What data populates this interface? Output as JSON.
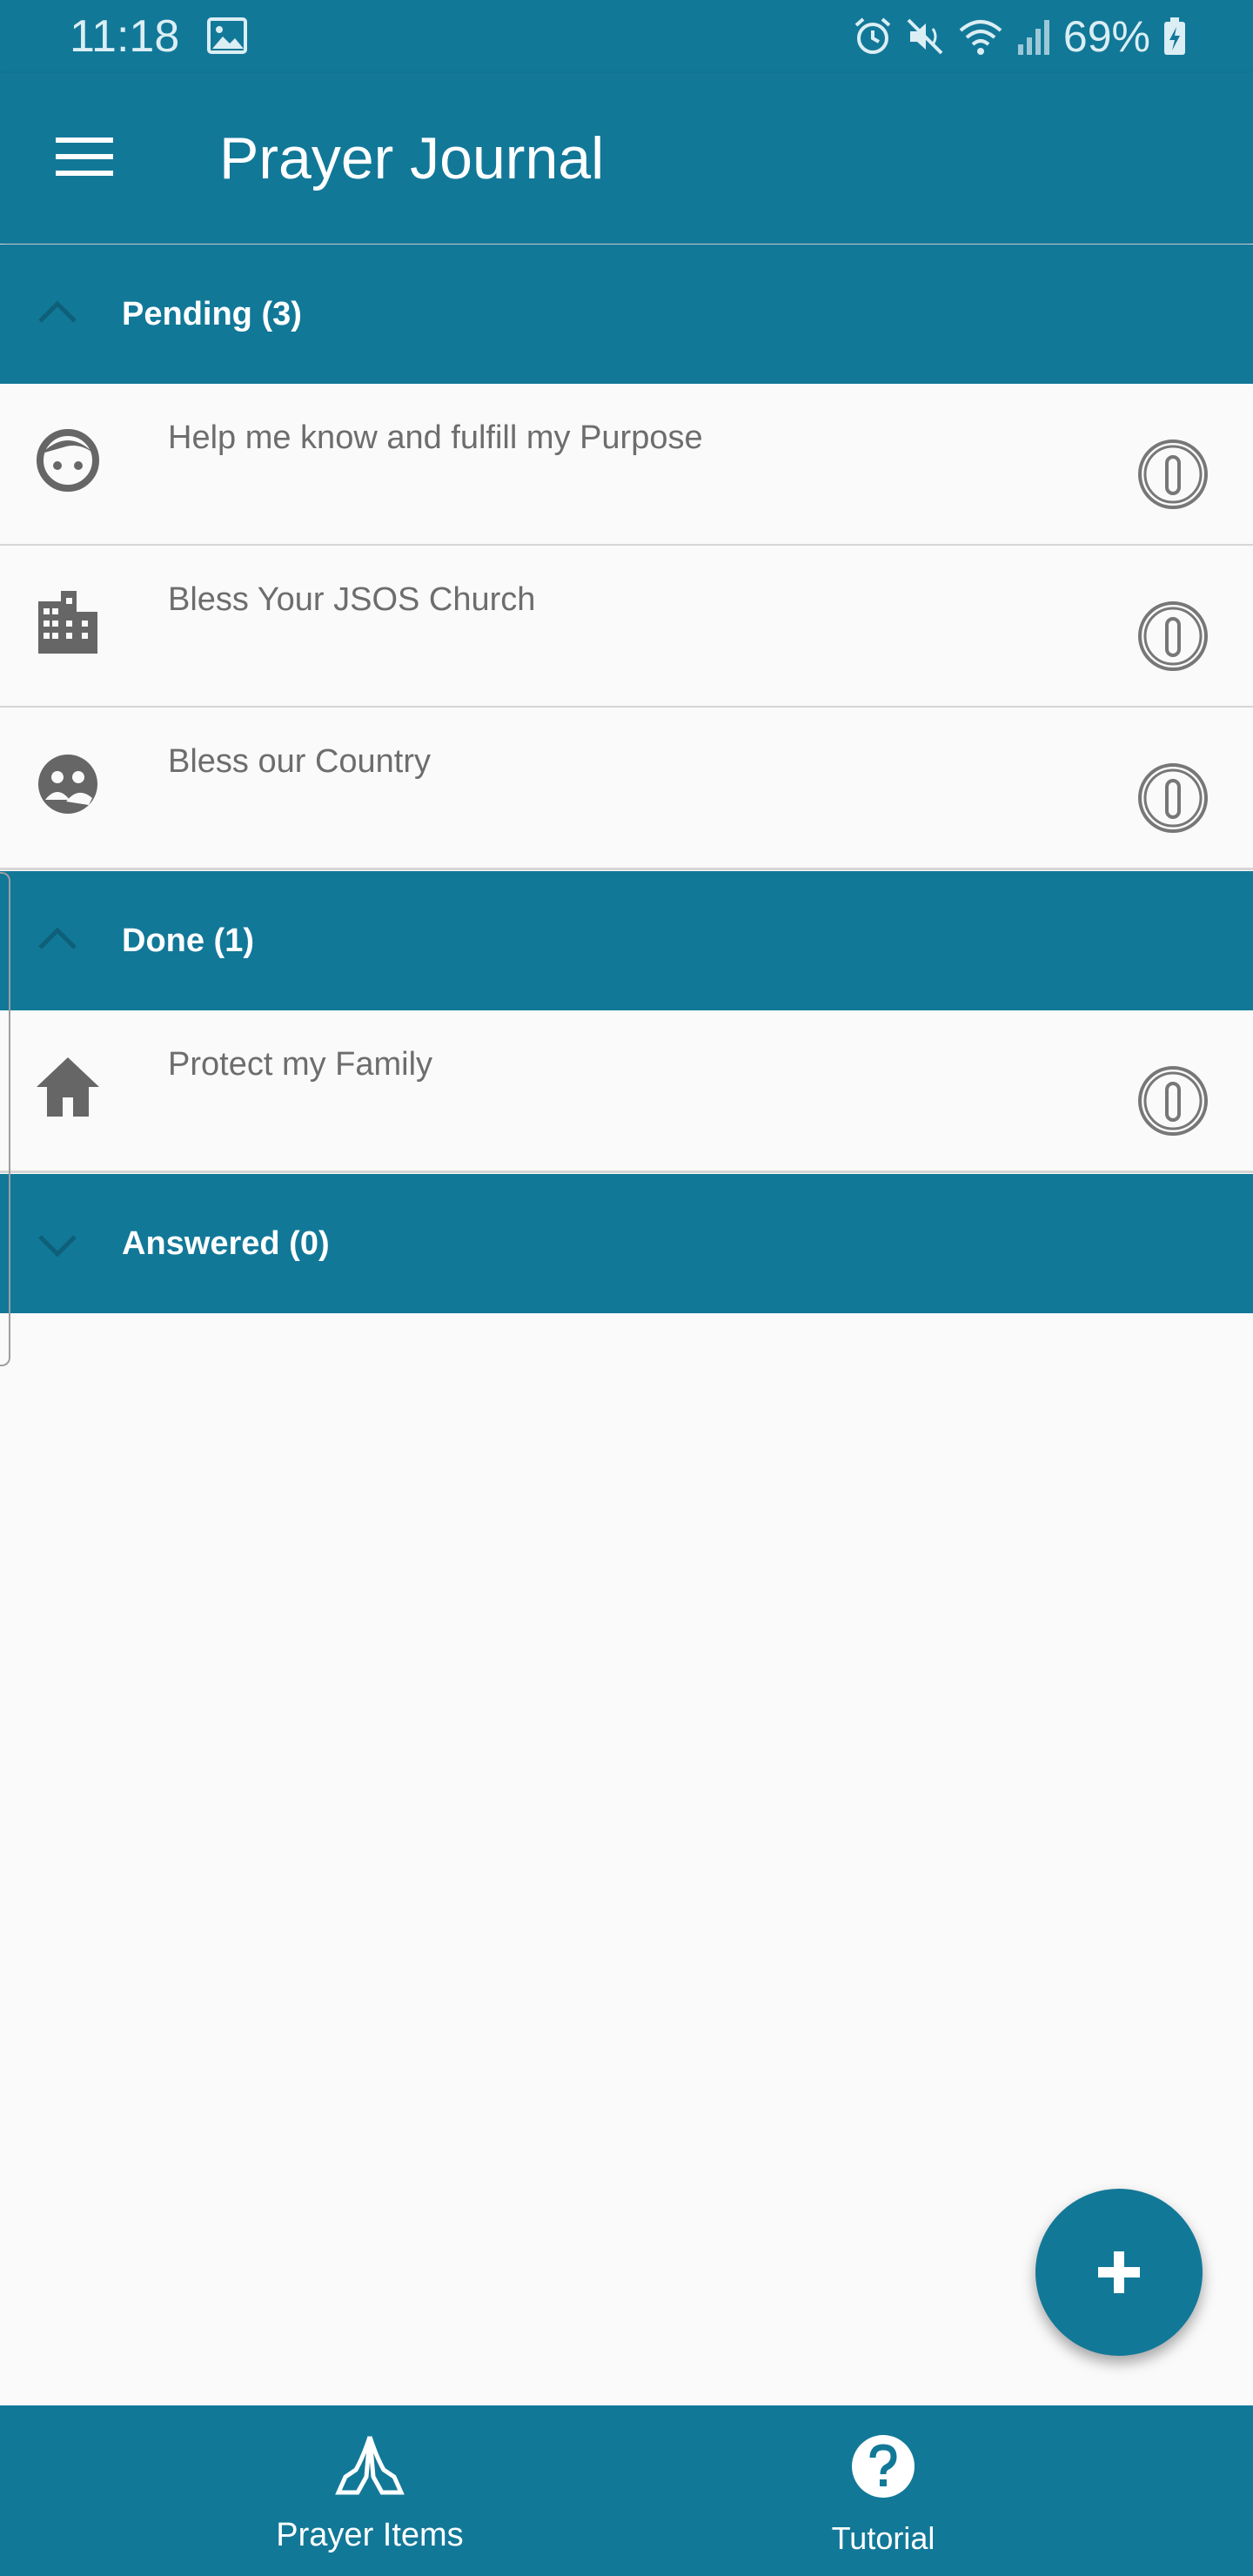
{
  "status_bar": {
    "time": "11:18",
    "battery": "69%",
    "icons": [
      "photo-icon",
      "alarm-icon",
      "mute-icon",
      "wifi-icon",
      "signal-icon",
      "battery-charging-icon"
    ]
  },
  "app_bar": {
    "title": "Prayer Journal",
    "menu_icon": "menu-icon"
  },
  "sections": {
    "pending": {
      "title": "Pending (3)",
      "expanded": true
    },
    "done": {
      "title": "Done (1)",
      "expanded": true
    },
    "answered": {
      "title": "Answered (0)",
      "expanded": false
    }
  },
  "pending_items": [
    {
      "text": "Help me know and fulfill my Purpose",
      "icon": "face-icon"
    },
    {
      "text": "Bless Your JSOS Church",
      "icon": "building-icon"
    },
    {
      "text": "Bless our Country",
      "icon": "globe-people-icon"
    }
  ],
  "done_items": [
    {
      "text": "Protect my Family",
      "icon": "home-icon"
    }
  ],
  "fab": {
    "icon": "plus-icon"
  },
  "bottom_nav": {
    "items": [
      {
        "label": "Prayer Items",
        "icon": "praying-hands-icon"
      },
      {
        "label": "Tutorial",
        "icon": "help-icon"
      }
    ]
  },
  "colors": {
    "primary": "#127898",
    "background": "#fafafa",
    "row_text": "#6d6d6d",
    "icon_gray": "#666666"
  }
}
